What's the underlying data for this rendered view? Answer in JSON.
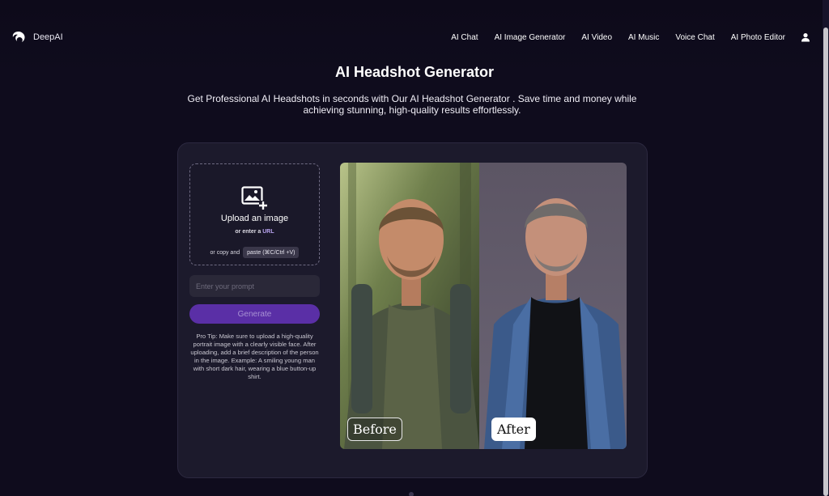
{
  "brand": {
    "name": "DeepAI"
  },
  "nav": {
    "items": [
      "AI Chat",
      "AI Image Generator",
      "AI Video",
      "AI Music",
      "Voice Chat",
      "AI Photo Editor"
    ]
  },
  "header": {
    "title": "AI Headshot Generator",
    "subtitle": "Get Professional AI Headshots in seconds with Our AI Headshot Generator . Save time and money while achieving stunning, high-quality results effortlessly."
  },
  "upload": {
    "title": "Upload an image",
    "url_prefix": "or enter a",
    "url_link": "URL",
    "paste_prefix": "or copy and",
    "paste_button": "paste (⌘C/Ctrl +V)"
  },
  "prompt": {
    "placeholder": "Enter your prompt"
  },
  "generate": {
    "label": "Generate"
  },
  "pro_tip": "Pro Tip: Make sure to upload a high-quality portrait image with a clearly visible face. After uploading, add a brief description of the person in the image. Example: A smiling young man with short dark hair, wearing a blue button-up shirt.",
  "comparison": {
    "before_label": "Before",
    "after_label": "After"
  },
  "icons": {
    "logo": "deepai-logo-icon",
    "user": "user-icon",
    "upload": "add-image-icon"
  },
  "colors": {
    "background": "#0f0c1d",
    "card": "#1c1a2c",
    "accent": "#5a2fa6",
    "link": "#b9a4f0"
  }
}
